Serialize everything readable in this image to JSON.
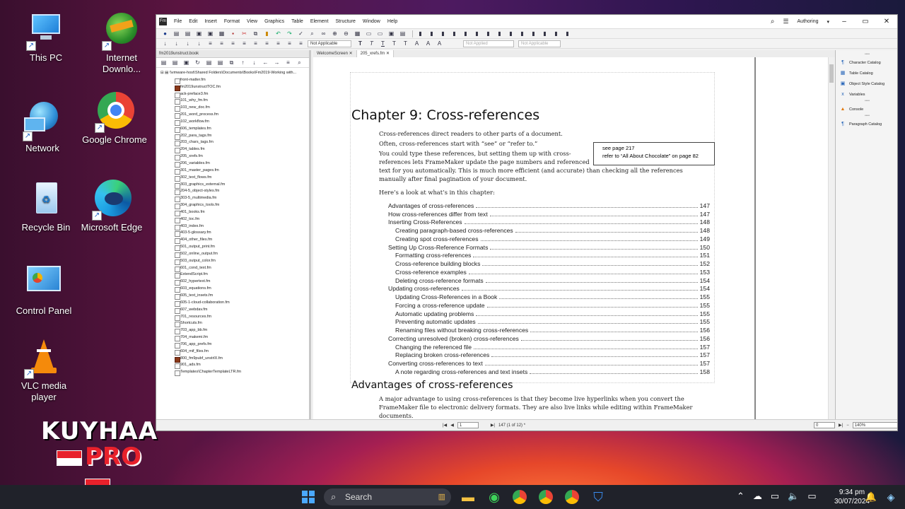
{
  "desktop": {
    "icons": [
      {
        "label": "This PC"
      },
      {
        "label": "Internet Downlo..."
      },
      {
        "label": "Network"
      },
      {
        "label": "Google Chrome"
      },
      {
        "label": "Recycle Bin"
      },
      {
        "label": "Microsoft Edge"
      },
      {
        "label": "Control Panel"
      },
      {
        "label": "VLC media player"
      }
    ],
    "watermark_top": "KUYHAA",
    "watermark_bottom": "PRO"
  },
  "window": {
    "app_icon": "Fm",
    "menu": [
      "File",
      "Edit",
      "Insert",
      "Format",
      "View",
      "Graphics",
      "Table",
      "Element",
      "Structure",
      "Window",
      "Help"
    ],
    "workspace": "Authoring",
    "style_combo": "Not Applicable",
    "disabled_combo_1": "Not Applied",
    "disabled_combo_2": "Not Applicable"
  },
  "left_pane": {
    "tab": "fm2019unstruct.book",
    "root": "\\\\vmware-host\\Shared Folders\\Documents\\Books\\Fm2019-Working with...",
    "files": [
      {
        "name": "front-matter.fm",
        "bold": false
      },
      {
        "name": "fm2019unstructTOC.fm",
        "bold": true
      },
      {
        "name": "ack-preface3.fm",
        "bold": false
      },
      {
        "name": "101_why_fm.fm",
        "bold": false
      },
      {
        "name": "103_new_doc.fm",
        "bold": false
      },
      {
        "name": "201_word_process.fm",
        "bold": false
      },
      {
        "name": "102_workflow.fm",
        "bold": false
      },
      {
        "name": "606_templates.fm",
        "bold": false
      },
      {
        "name": "202_para_tags.fm",
        "bold": false
      },
      {
        "name": "203_chars_tags.fm",
        "bold": false
      },
      {
        "name": "204_tables.fm",
        "bold": false
      },
      {
        "name": "205_xrefs.fm",
        "bold": false
      },
      {
        "name": "206_variables.fm",
        "bold": false
      },
      {
        "name": "301_master_pages.fm",
        "bold": false
      },
      {
        "name": "302_text_flows.fm",
        "bold": false
      },
      {
        "name": "303_graphics_external.fm",
        "bold": false
      },
      {
        "name": "204-5_object-styles.fm",
        "bold": false
      },
      {
        "name": "303-5_multimedia.fm",
        "bold": false
      },
      {
        "name": "304_graphics_tools.fm",
        "bold": false
      },
      {
        "name": "401_books.fm",
        "bold": false
      },
      {
        "name": "402_toc.fm",
        "bold": false
      },
      {
        "name": "403_index.fm",
        "bold": false
      },
      {
        "name": "403-5-glossary.fm",
        "bold": false
      },
      {
        "name": "404_other_files.fm",
        "bold": false
      },
      {
        "name": "501_output_print.fm",
        "bold": false
      },
      {
        "name": "502_online_output.fm",
        "bold": false
      },
      {
        "name": "503_output_color.fm",
        "bold": false
      },
      {
        "name": "601_cond_text.fm",
        "bold": false
      },
      {
        "name": "ExtendScript.fm",
        "bold": false
      },
      {
        "name": "602_hypertext.fm",
        "bold": false
      },
      {
        "name": "603_equations.fm",
        "bold": false
      },
      {
        "name": "605_text_insets.fm",
        "bold": false
      },
      {
        "name": "605-1-cloud-collaboration.fm",
        "bold": false
      },
      {
        "name": "607_webdav.fm",
        "bold": false
      },
      {
        "name": "701_resources.fm",
        "bold": false
      },
      {
        "name": "Shortcuts.fm",
        "bold": false
      },
      {
        "name": "703_app_bb.fm",
        "bold": false
      },
      {
        "name": "704_makemi.fm",
        "bold": false
      },
      {
        "name": "706_app_prefs.fm",
        "bold": false
      },
      {
        "name": "604_mif_files.fm",
        "bold": false
      },
      {
        "name": "800_fm9pubf_unstrlX.fm",
        "bold": true
      },
      {
        "name": "901_ads.fm",
        "bold": false
      },
      {
        "name": "Templates\\ChapterTemplateLTR.fm",
        "bold": false
      }
    ]
  },
  "doc_tabs": [
    "WelcomeScreen",
    "205_xrefs.fm"
  ],
  "document": {
    "chapter_title": "Chapter 9: Cross-references",
    "p1": "Cross-references direct readers to other parts of a document.",
    "p2": "Often, cross-references start with “see” or “refer to.”",
    "p3a": "You could type these references, but setting them up with cross-",
    "p3b": "references lets FrameMaker update the page numbers and referenced",
    "p3c": "text for you automatically. This is much more efficient (and accurate) than checking all the references",
    "p3d": "manually after final pagination of your document.",
    "callout_1": "see page 217",
    "callout_2": "refer to “All About Chocolate” on page 82",
    "p4": "Here’s a look at what’s in this chapter:",
    "toc": [
      {
        "text": "Advantages of cross-references",
        "page": "147",
        "level": 1
      },
      {
        "text": "How cross-references differ from text",
        "page": "147",
        "level": 1
      },
      {
        "text": "Inserting Cross-References",
        "page": "148",
        "level": 1
      },
      {
        "text": "Creating paragraph-based cross-references",
        "page": "148",
        "level": 2
      },
      {
        "text": "Creating spot cross-references",
        "page": "149",
        "level": 2
      },
      {
        "text": "Setting Up Cross-Reference Formats",
        "page": "150",
        "level": 1
      },
      {
        "text": "Formatting cross-references",
        "page": "151",
        "level": 2
      },
      {
        "text": "Cross-reference building blocks",
        "page": "152",
        "level": 2
      },
      {
        "text": "Cross-reference examples",
        "page": "153",
        "level": 2
      },
      {
        "text": "Deleting cross-reference formats",
        "page": "154",
        "level": 2
      },
      {
        "text": "Updating cross-references",
        "page": "154",
        "level": 1
      },
      {
        "text": "Updating Cross-References in a Book",
        "page": "155",
        "level": 2
      },
      {
        "text": "Forcing a cross-reference update",
        "page": "155",
        "level": 2
      },
      {
        "text": "Automatic updating problems",
        "page": "155",
        "level": 2
      },
      {
        "text": "Preventing automatic updates",
        "page": "155",
        "level": 2
      },
      {
        "text": "Renaming files without breaking cross-references",
        "page": "156",
        "level": 2
      },
      {
        "text": "Correcting unresolved (broken) cross-references",
        "page": "156",
        "level": 1
      },
      {
        "text": "Changing the referenced file",
        "page": "157",
        "level": 2
      },
      {
        "text": "Replacing broken cross-references",
        "page": "157",
        "level": 2
      },
      {
        "text": "Converting cross-references to text",
        "page": "157",
        "level": 1
      },
      {
        "text": "A note regarding cross-references and text insets",
        "page": "158",
        "level": 2
      }
    ],
    "h2": "Advantages of cross-references",
    "p5a": "A major advantage to using cross-references is that they become live hyperlinks when you convert the",
    "p5b": "FrameMaker file to electronic delivery formats. They are also live links while editing within FrameMaker",
    "p5c": "documents."
  },
  "right_panel": [
    {
      "label": "Character Catalog",
      "icon": "character-catalog-icon"
    },
    {
      "label": "Table Catalog",
      "icon": "table-catalog-icon"
    },
    {
      "label": "Object Style Catalog",
      "icon": "object-style-icon"
    },
    {
      "label": "Variables",
      "icon": "variables-icon"
    },
    {
      "label": "Console",
      "icon": "warning-icon"
    },
    {
      "label": "Paragraph Catalog",
      "icon": "paragraph-catalog-icon"
    }
  ],
  "status": {
    "page_input": "1",
    "page_info": "147 (1 of 12) *",
    "pos_value": "0",
    "zoom": "140%"
  },
  "taskbar": {
    "search": "Search",
    "time": "9:34 pm",
    "date": "30/07/2024"
  }
}
